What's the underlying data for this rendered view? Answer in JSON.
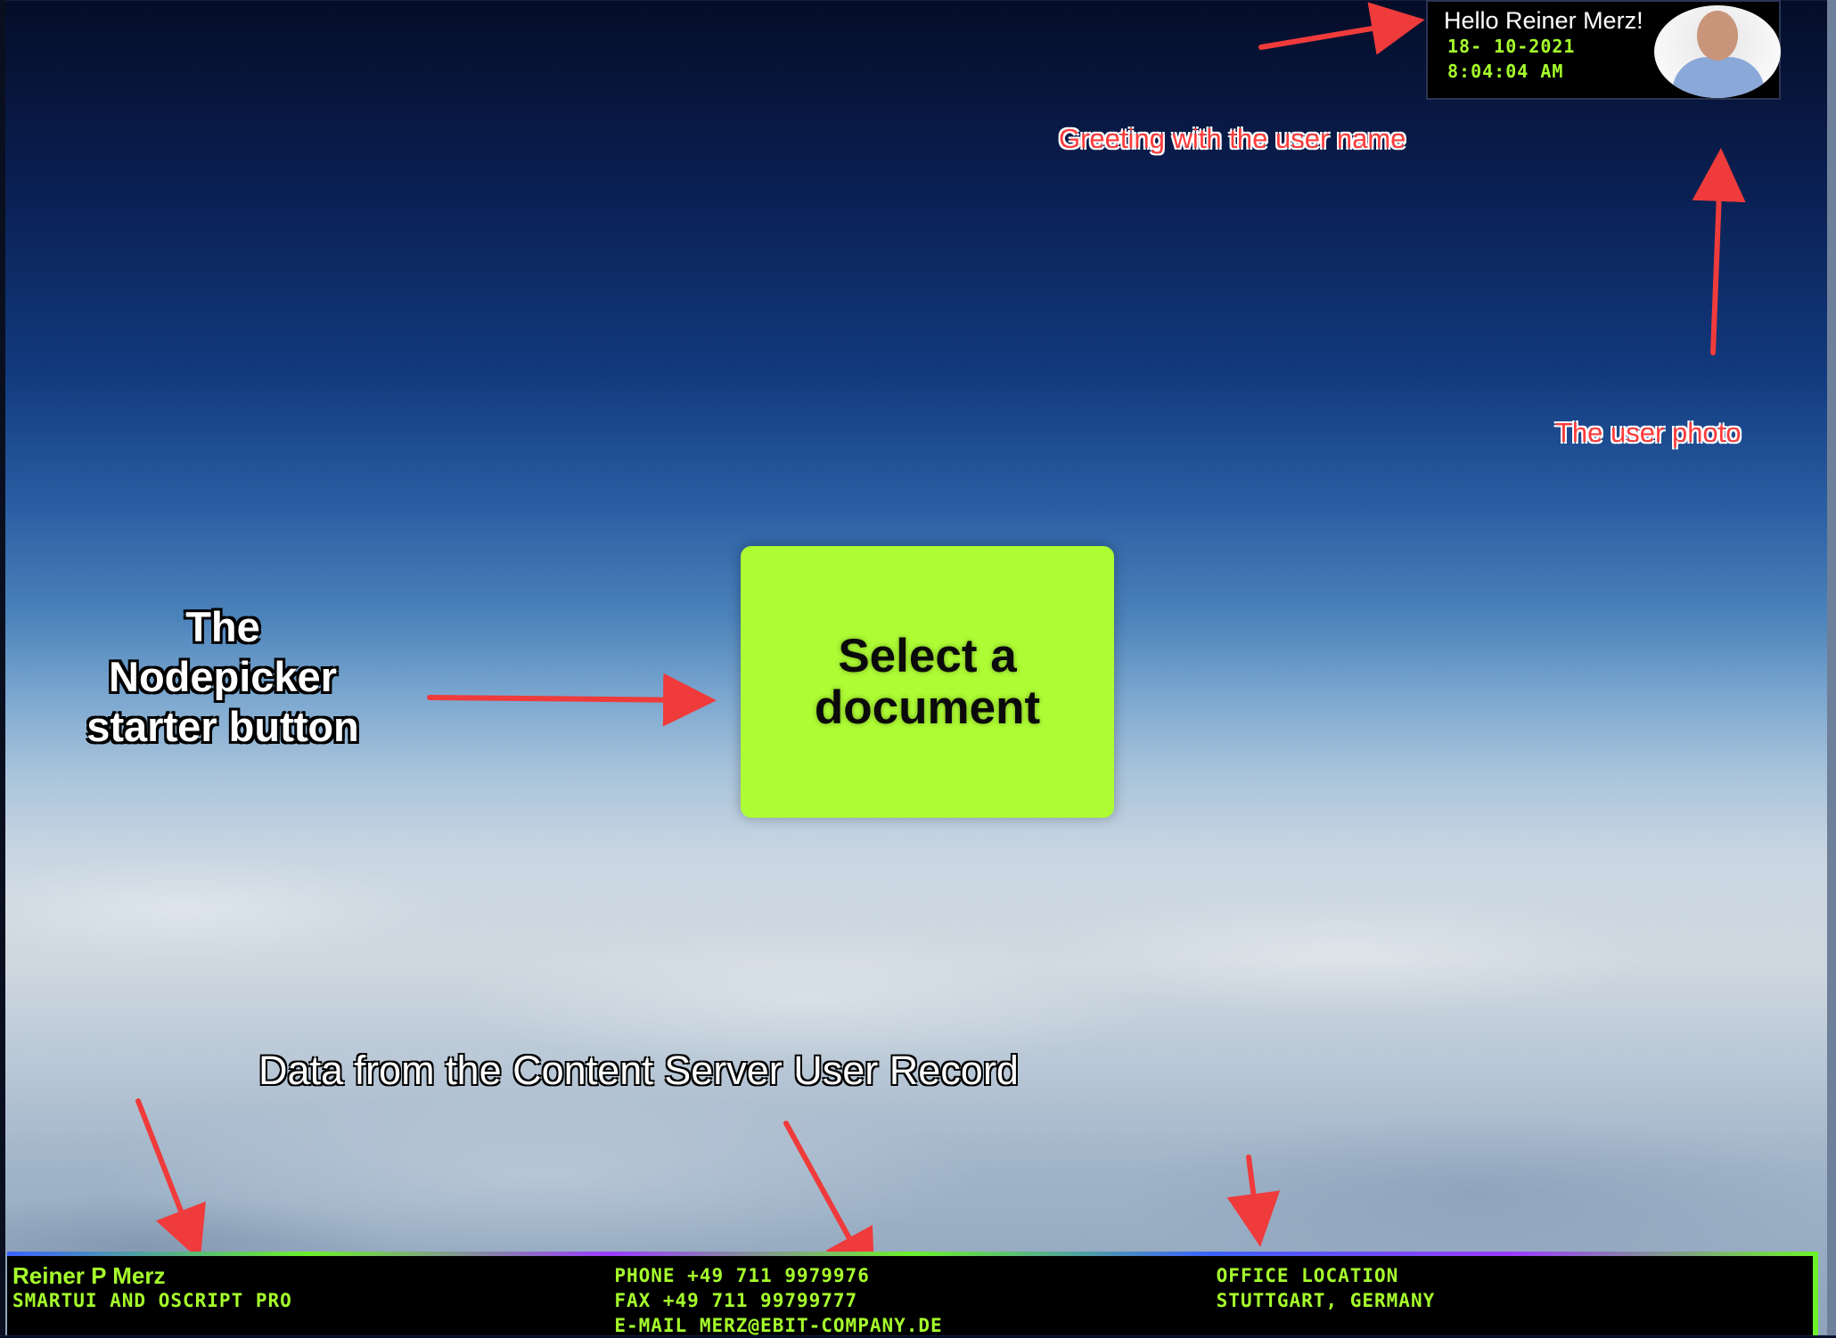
{
  "user_widget": {
    "greeting": "Hello Reiner Merz!",
    "date": "18- 10-2021",
    "time": "8:04:04 AM",
    "photo_icon": "user-photo"
  },
  "annotations": {
    "greeting": "Greeting with the user name",
    "photo": "The user photo",
    "nodepicker_lines": [
      "The",
      "Nodepicker",
      "starter button"
    ],
    "data_source": "Data from the Content Server User Record"
  },
  "select_button": {
    "lines": [
      "Select a",
      "document"
    ]
  },
  "colors": {
    "accent": "#aefc34",
    "terminal_text": "#a6ff2c",
    "annotation": "#ff3b3b"
  },
  "footer": {
    "panel1": {
      "name": "Reiner P Merz",
      "title": "SMARTUI AND OSCRIPT PRO"
    },
    "panel2": {
      "phone": "PHONE +49 711 9979976",
      "fax": "FAX +49 711 99799777",
      "email": "E-MAIL MERZ@EBIT-COMPANY.DE"
    },
    "panel3": {
      "label": "OFFICE LOCATION",
      "location": "STUTTGART, GERMANY"
    }
  }
}
